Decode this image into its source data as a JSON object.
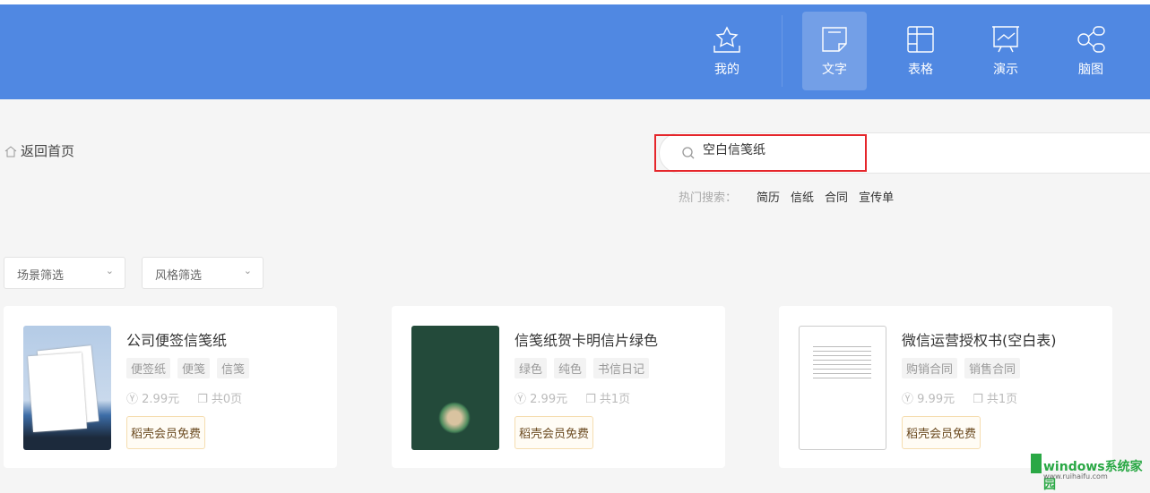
{
  "header": {
    "nav": [
      {
        "label": "我的",
        "icon": "star-icon"
      },
      {
        "label": "文字",
        "icon": "document-icon",
        "active": true
      },
      {
        "label": "表格",
        "icon": "table-icon"
      },
      {
        "label": "演示",
        "icon": "presentation-icon"
      },
      {
        "label": "脑图",
        "icon": "mindmap-icon"
      }
    ]
  },
  "back": {
    "label": "返回首页",
    "icon": "home-icon"
  },
  "search": {
    "value": "空白信笺纸"
  },
  "hot": {
    "label": "热门搜索：",
    "items": [
      "简历",
      "信纸",
      "合同",
      "宣传单"
    ]
  },
  "filters": [
    "场景筛选",
    "风格筛选"
  ],
  "cards": [
    {
      "title": "公司便签信笺纸",
      "tags": [
        "便签纸",
        "便笺",
        "信笺"
      ],
      "price": "2.99元",
      "pages": "共0页",
      "vip": "稻壳会员免费"
    },
    {
      "title": "信笺纸贺卡明信片绿色",
      "tags": [
        "绿色",
        "纯色",
        "书信日记"
      ],
      "price": "2.99元",
      "pages": "共1页",
      "vip": "稻壳会员免费"
    },
    {
      "title": "微信运营授权书(空白表)",
      "tags": [
        "购销合同",
        "销售合同"
      ],
      "price": "9.99元",
      "pages": "共1页",
      "vip": "稻壳会员免费"
    }
  ],
  "watermark": {
    "brand": "windows系统家园",
    "url": "www.ruihaifu.com"
  },
  "colors": {
    "header": "#5088e2",
    "highlight": "#e5262b"
  }
}
